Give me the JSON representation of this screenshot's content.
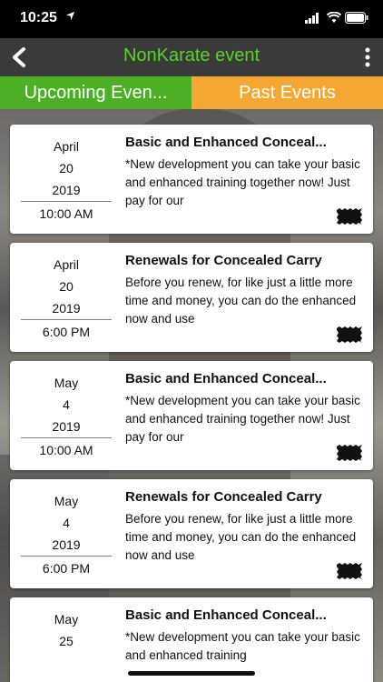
{
  "status": {
    "time": "10:25"
  },
  "nav": {
    "title": "NonKarate event"
  },
  "tabs": {
    "upcoming": "Upcoming Even...",
    "past": "Past Events"
  },
  "events": [
    {
      "month": "April",
      "day": "20",
      "year": "2019",
      "time": "10:00 AM",
      "title": "Basic and Enhanced Conceal...",
      "desc": "*New development you can take your basic and enhanced training together now!  Just pay for our"
    },
    {
      "month": "April",
      "day": "20",
      "year": "2019",
      "time": "6:00 PM",
      "title": "Renewals for Concealed Carry",
      "desc": "Before you renew,  for like just a little more time and money,  you can do the enhanced now and use"
    },
    {
      "month": "May",
      "day": "4",
      "year": "2019",
      "time": "10:00 AM",
      "title": "Basic and Enhanced Conceal...",
      "desc": "*New development you can take your basic and enhanced training together now!  Just pay for our"
    },
    {
      "month": "May",
      "day": "4",
      "year": "2019",
      "time": "6:00 PM",
      "title": "Renewals for Concealed Carry",
      "desc": "Before you renew,  for like just a little more time and money,  you can do the enhanced now and use"
    },
    {
      "month": "May",
      "day": "25",
      "year": "",
      "time": "",
      "title": "Basic and Enhanced Conceal...",
      "desc": "*New development you can take your basic and enhanced training"
    }
  ]
}
